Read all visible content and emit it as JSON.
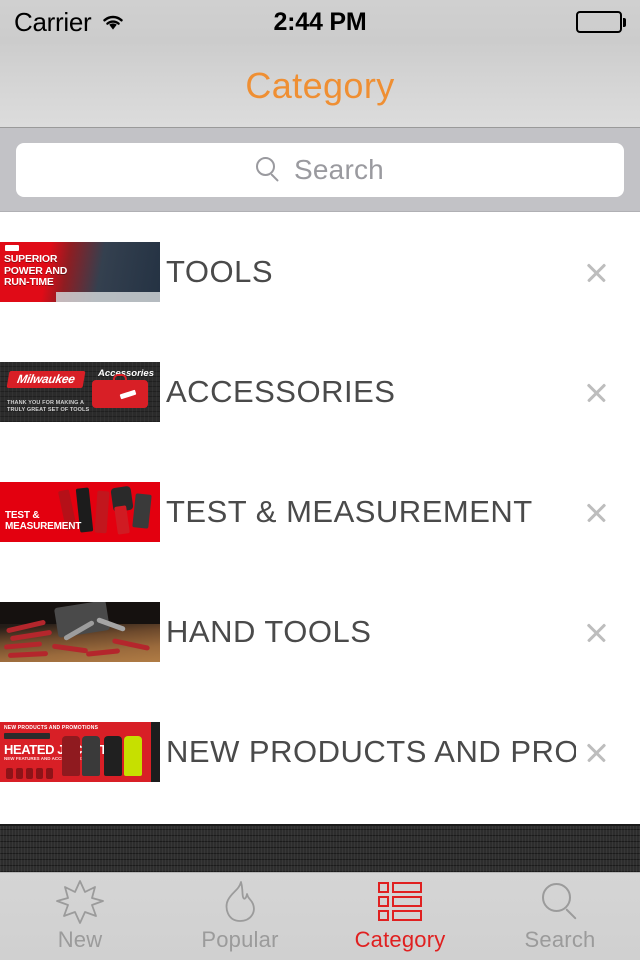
{
  "status_bar": {
    "carrier": "Carrier",
    "wifi_icon": "wifi-icon",
    "time": "2:44 PM",
    "battery_icon": "battery-full-icon"
  },
  "nav_bar": {
    "title": "Category",
    "title_color": "#ef8f33"
  },
  "search": {
    "placeholder": "Search",
    "value": "",
    "icon": "search-icon"
  },
  "list": {
    "items": [
      {
        "label": "TOOLS",
        "thumb_text": [
          "SUPERIOR",
          "POWER AND",
          "RUN-TIME"
        ],
        "accessory_icon": "chevron-right-icon"
      },
      {
        "label": "ACCESSORIES",
        "thumb_text": [
          "Milwaukee",
          "Accessories",
          "THANK YOU FOR MAKING A TRULY GREAT SET OF TOOLS"
        ],
        "accessory_icon": "chevron-right-icon"
      },
      {
        "label": "TEST & MEASUREMENT",
        "thumb_text": [
          "TEST &",
          "MEASUREMENT"
        ],
        "accessory_icon": "chevron-right-icon"
      },
      {
        "label": "HAND TOOLS",
        "thumb_text": [],
        "accessory_icon": "chevron-right-icon"
      },
      {
        "label": "NEW PRODUCTS AND PROMOT",
        "thumb_text": [
          "NEW PRODUCTS AND PROMOTIONS",
          "CORDLESS",
          "HEATED JACKET",
          "NEW FEATURES AND ACCESSORIES"
        ],
        "accessory_icon": "chevron-right-icon"
      }
    ]
  },
  "tab_bar": {
    "active_color": "#e02020",
    "inactive_color": "#9b9b9b",
    "tabs": [
      {
        "label": "New",
        "icon": "star-burst-icon",
        "active": false
      },
      {
        "label": "Popular",
        "icon": "flame-icon",
        "active": false
      },
      {
        "label": "Category",
        "icon": "list-icon",
        "active": true
      },
      {
        "label": "Search",
        "icon": "search-icon",
        "active": false
      }
    ]
  }
}
